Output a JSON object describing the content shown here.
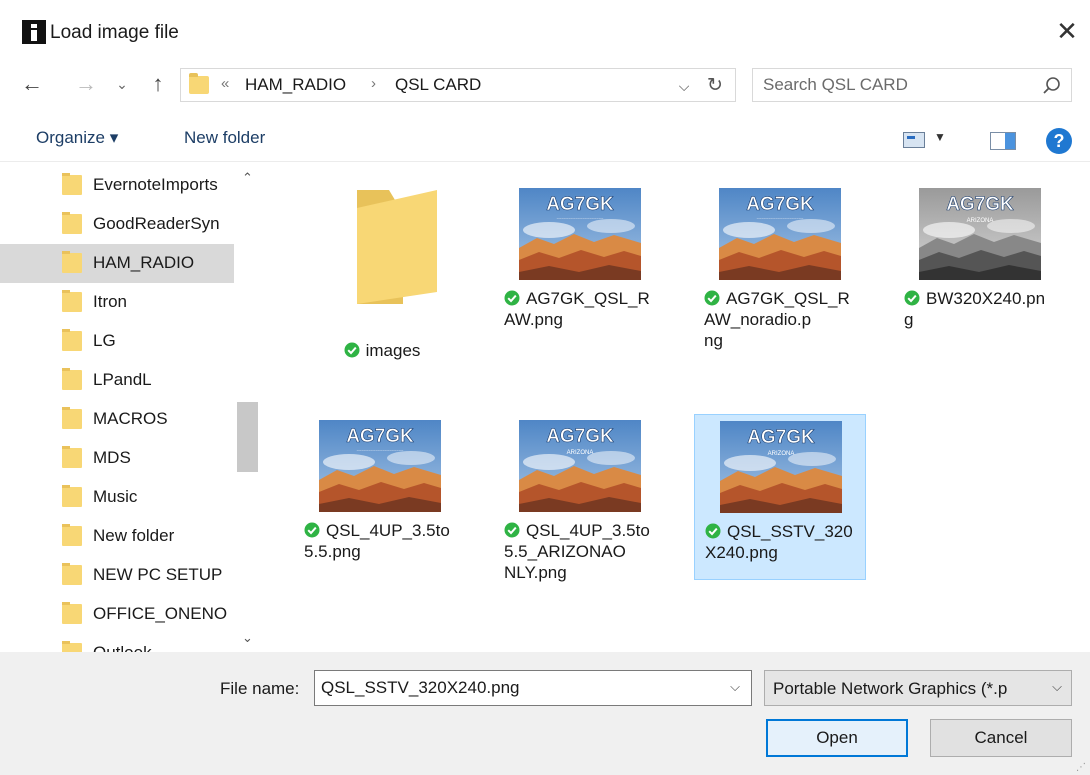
{
  "window": {
    "title": "Load image file",
    "close_glyph": "✕"
  },
  "nav": {
    "back_glyph": "←",
    "forward_glyph": "→",
    "history_glyph": "⌄",
    "up_glyph": "↑"
  },
  "address": {
    "overflow_glyph": "«",
    "crumbs": [
      "HAM_RADIO",
      "QSL CARD"
    ],
    "separator": "›",
    "dropdown_glyph": "⌵",
    "refresh_glyph": "↻"
  },
  "search": {
    "placeholder": "Search QSL CARD"
  },
  "toolbar": {
    "organize_label": "Organize ▾",
    "new_folder_label": "New folder",
    "views_dropdown_glyph": "▼",
    "help_glyph": "?"
  },
  "navpane": {
    "items": [
      {
        "label": "EvernoteImports",
        "selected": false
      },
      {
        "label": "GoodReaderSyn",
        "selected": false
      },
      {
        "label": "HAM_RADIO",
        "selected": true
      },
      {
        "label": "Itron",
        "selected": false
      },
      {
        "label": "LG",
        "selected": false
      },
      {
        "label": "LPandL",
        "selected": false
      },
      {
        "label": "MACROS",
        "selected": false
      },
      {
        "label": "MDS",
        "selected": false
      },
      {
        "label": "Music",
        "selected": false
      },
      {
        "label": "New folder",
        "selected": false
      },
      {
        "label": "NEW PC SETUP",
        "selected": false
      },
      {
        "label": "OFFICE_ONENO",
        "selected": false
      },
      {
        "label": "Outlook",
        "selected": false
      }
    ],
    "scroll_up_glyph": "⌃",
    "scroll_down_glyph": "⌄"
  },
  "files": [
    {
      "lines": [
        "images"
      ],
      "kind": "folder",
      "selected": false
    },
    {
      "lines": [
        "AG7GK_QSL_R",
        "AW.png"
      ],
      "kind": "image",
      "thumb_text": "AG7GK",
      "style": "color",
      "selected": false
    },
    {
      "lines": [
        "AG7GK_QSL_R",
        "AW_noradio.p",
        "ng"
      ],
      "kind": "image",
      "thumb_text": "AG7GK",
      "style": "color",
      "selected": false
    },
    {
      "lines": [
        "BW320X240.pn",
        "g"
      ],
      "kind": "image",
      "thumb_text": "AG7GK",
      "subtext": "ARIZONA",
      "style": "bw",
      "selected": false
    },
    {
      "lines": [
        "QSL_4UP_3.5to",
        "5.5.png"
      ],
      "kind": "image",
      "thumb_text": "AG7GK",
      "style": "color",
      "selected": false
    },
    {
      "lines": [
        "QSL_4UP_3.5to",
        "5.5_ARIZONAO",
        "NLY.png"
      ],
      "kind": "image",
      "thumb_text": "AG7GK",
      "subtext": "ARIZONA",
      "style": "color",
      "selected": false
    },
    {
      "lines": [
        "QSL_SSTV_320",
        "X240.png"
      ],
      "kind": "image",
      "thumb_text": "AG7GK",
      "subtext": "ARIZONA",
      "style": "color",
      "selected": true
    }
  ],
  "bottom": {
    "filename_label": "File name:",
    "filename_value": "QSL_SSTV_320X240.png",
    "filename_dropdown_glyph": "⌵",
    "filter_value": "Portable Network Graphics (*.p",
    "filter_dropdown_glyph": "⌵",
    "open_label": "Open",
    "cancel_label": "Cancel"
  },
  "colors": {
    "folder": "#f8d775",
    "selection_bg": "#cce8ff",
    "selection_border": "#99d1ff",
    "sync_green": "#2fb344",
    "accent": "#0078d7"
  }
}
